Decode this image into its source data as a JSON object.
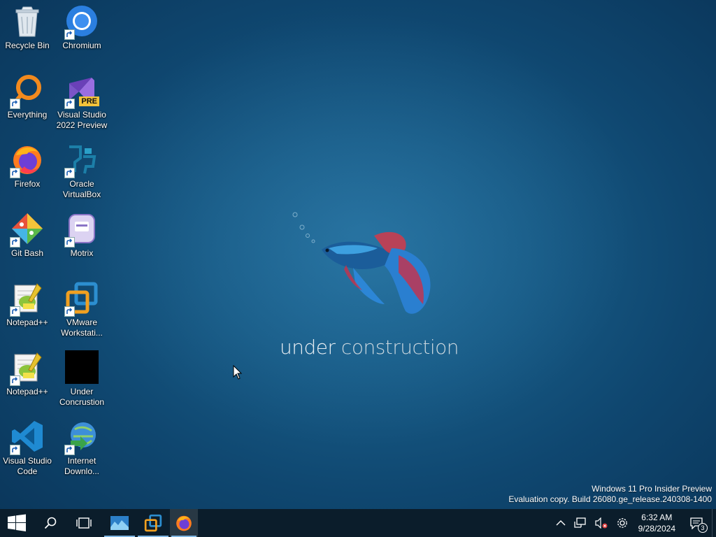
{
  "desktop": {
    "icons": [
      {
        "label": "Recycle Bin",
        "icon": "recycle-bin-icon"
      },
      {
        "label": "Chromium",
        "icon": "chromium-icon"
      },
      {
        "label": "Everything",
        "icon": "everything-icon"
      },
      {
        "label": "Visual Studio\n2022 Preview",
        "icon": "visual-studio-icon",
        "badge": "PRE"
      },
      {
        "label": "Firefox",
        "icon": "firefox-icon"
      },
      {
        "label": "Oracle\nVirtualBox",
        "icon": "virtualbox-icon"
      },
      {
        "label": "Git Bash",
        "icon": "git-bash-icon"
      },
      {
        "label": "Motrix",
        "icon": "motrix-icon"
      },
      {
        "label": "Notepad++",
        "icon": "notepadpp-icon"
      },
      {
        "label": "VMware\nWorkstati...",
        "icon": "vmware-icon"
      },
      {
        "label": "Notepad++",
        "icon": "notepadpp-icon"
      },
      {
        "label": "Under\nConcrustion",
        "icon": "black-square-icon"
      },
      {
        "label": "Visual Studio\nCode",
        "icon": "vscode-icon"
      },
      {
        "label": "Internet\nDownlo...",
        "icon": "idm-icon"
      }
    ]
  },
  "wallpaper": {
    "text_bold": "under",
    "text_light": "construction"
  },
  "watermark": {
    "line1": "Windows 11 Pro Insider Preview",
    "line2": "Evaluation copy. Build 26080.ge_release.240308-1400"
  },
  "taskbar": {
    "pinned": [
      {
        "name": "photos-app-icon",
        "state": "running"
      },
      {
        "name": "vmware-app-icon",
        "state": "running"
      },
      {
        "name": "firefox-app-icon",
        "state": "active"
      }
    ],
    "clock": {
      "time": "6:32 AM",
      "date": "9/28/2024"
    },
    "notification_count": "3"
  },
  "colors": {
    "taskbar_bg": "#0b1d2b",
    "accent": "#7fb6e2",
    "wallpaper": "#175a85"
  }
}
